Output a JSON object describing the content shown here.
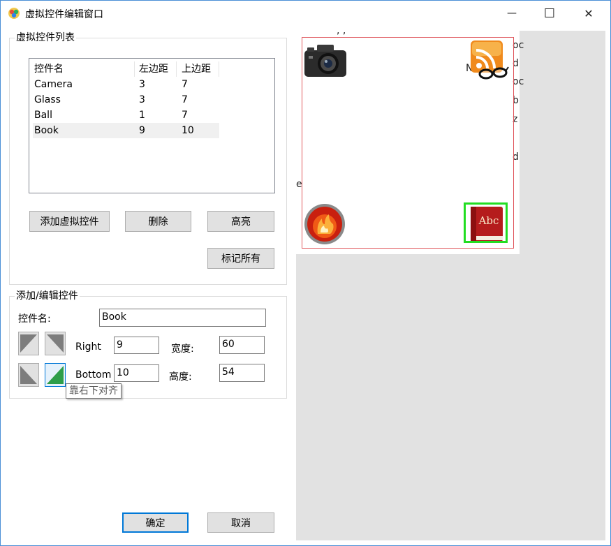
{
  "window": {
    "title": "虚拟控件编辑窗口",
    "minimize_glyph": "—",
    "maximize_glyph": "☐",
    "close_glyph": "✕"
  },
  "list_group": {
    "label": "虚拟控件列表",
    "columns": [
      "控件名",
      "左边距",
      "上边距"
    ],
    "rows": [
      {
        "name": "Camera",
        "left": "3",
        "top": "7"
      },
      {
        "name": "Glass",
        "left": "3",
        "top": "7"
      },
      {
        "name": "Ball",
        "left": "1",
        "top": "7"
      },
      {
        "name": "Book",
        "left": "9",
        "top": "10"
      }
    ],
    "selected_index": 3,
    "buttons": {
      "add": "添加虚拟控件",
      "delete": "删除",
      "highlight": "高亮",
      "mark_all": "标记所有"
    }
  },
  "edit_group": {
    "label": "添加/编辑控件",
    "name_label": "控件名:",
    "name_value": "Book",
    "right_label": "Right",
    "right_value": "9",
    "width_label": "宽度:",
    "width_value": "60",
    "bottom_label": "Bottom",
    "bottom_value": "10",
    "height_label": "高度:",
    "height_value": "54",
    "tooltip": "靠右下对齐"
  },
  "footer": {
    "ok": "确定",
    "cancel": "取消"
  },
  "preview": {
    "ghost_texts": [
      ", ,",
      "oc",
      "d",
      "oc",
      "b",
      "z",
      "d",
      "e",
      "N"
    ],
    "icons": [
      "camera-icon",
      "rss-glasses-icon",
      "fire-ball-icon",
      "book-icon"
    ],
    "book_label": "Abc",
    "colors": {
      "frame": "#e0585e",
      "selection": "#22dd22",
      "panel_bg": "#e2e2e2"
    }
  }
}
